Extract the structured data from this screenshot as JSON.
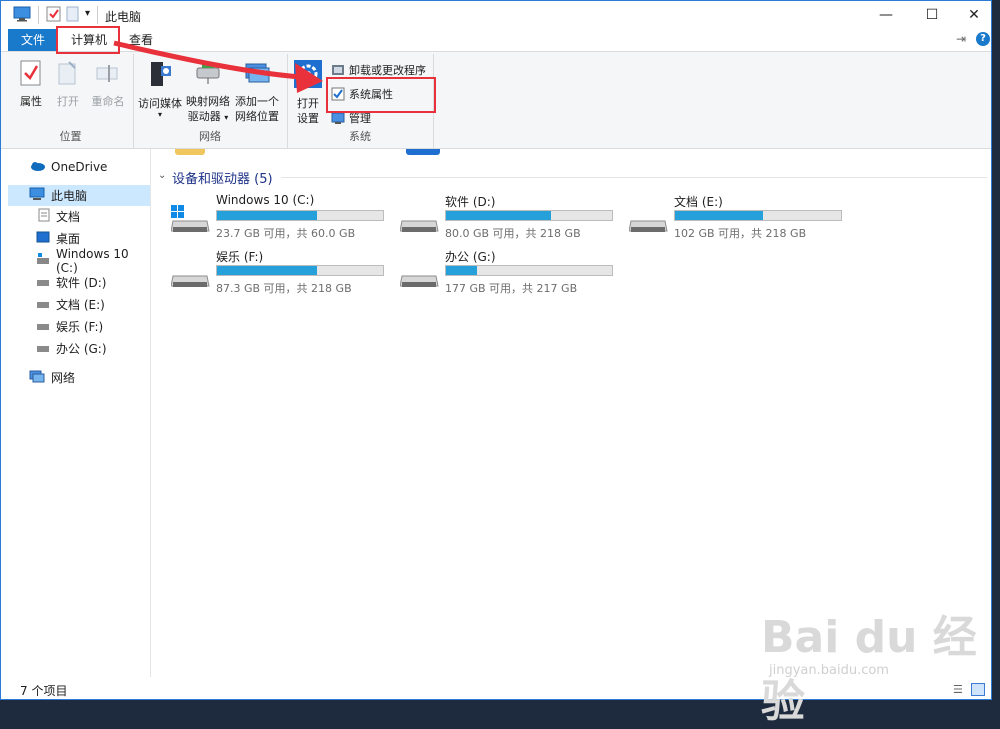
{
  "window": {
    "title": "此电脑"
  },
  "tabs": {
    "file": "文件",
    "computer": "计算机",
    "view": "查看"
  },
  "ribbon": {
    "location": {
      "label": "位置",
      "properties": "属性",
      "open": "打开",
      "rename": "重命名"
    },
    "network": {
      "label": "网络",
      "access_media": "访问媒体",
      "map_drive_1": "映射网络",
      "map_drive_2": "驱动器",
      "add_location_1": "添加一个",
      "add_location_2": "网络位置"
    },
    "system": {
      "label": "系统",
      "open_settings_1": "打开",
      "open_settings_2": "设置",
      "uninstall": "卸载或更改程序",
      "system_properties": "系统属性",
      "manage": "管理"
    }
  },
  "nav": {
    "items": [
      {
        "label": "OneDrive"
      },
      {
        "label": "此电脑"
      },
      {
        "label": "文档"
      },
      {
        "label": "桌面"
      },
      {
        "label": "Windows 10 (C:)"
      },
      {
        "label": "软件 (D:)"
      },
      {
        "label": "文档 (E:)"
      },
      {
        "label": "娱乐 (F:)"
      },
      {
        "label": "办公 (G:)"
      },
      {
        "label": "网络"
      }
    ]
  },
  "content": {
    "section_title": "设备和驱动器 (5)",
    "drives": [
      {
        "name": "Windows 10 (C:)",
        "info": "23.7 GB 可用，共 60.0 GB",
        "used_fraction": 0.605
      },
      {
        "name": "软件 (D:)",
        "info": "80.0 GB 可用，共 218 GB",
        "used_fraction": 0.633
      },
      {
        "name": "文档 (E:)",
        "info": "102 GB 可用，共 218 GB",
        "used_fraction": 0.532
      },
      {
        "name": "娱乐 (F:)",
        "info": "87.3 GB 可用，共 218 GB",
        "used_fraction": 0.6
      },
      {
        "name": "办公 (G:)",
        "info": "177 GB 可用，共 217 GB",
        "used_fraction": 0.184
      }
    ]
  },
  "status": {
    "count": "7 个项目"
  },
  "watermark": {
    "logo": "Bai du 经验",
    "url": "jingyan.baidu.com"
  },
  "colors": {
    "accent": "#1979ca",
    "bar_fill": "#26a0da",
    "highlight": "#e8313b"
  }
}
